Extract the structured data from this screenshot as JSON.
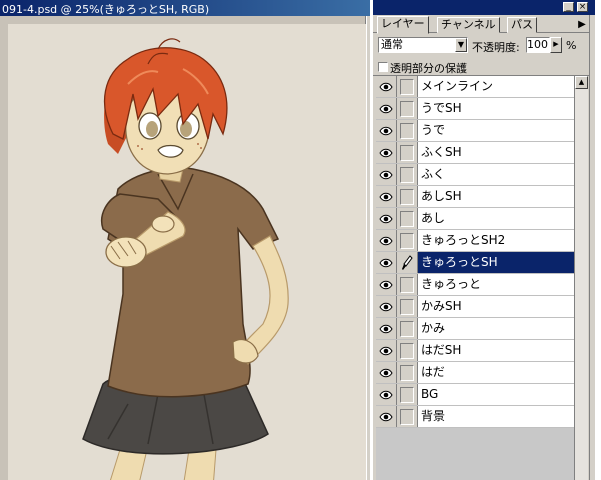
{
  "document": {
    "title": "091-4.psd @ 25%(きゅろっとSH, RGB)"
  },
  "palette": {
    "tabs": [
      "レイヤー",
      "チャンネル",
      "パス"
    ],
    "active_tab": "レイヤー",
    "window_buttons": [
      "_",
      "×"
    ],
    "tab_menu_icon": "▶",
    "blend_mode": "通常",
    "opacity_label": "不透明度:",
    "opacity_value": "100",
    "opacity_unit": "%",
    "preserve_transparency_label": "透明部分の保護",
    "preserve_transparency_checked": false,
    "layers": [
      {
        "name": "メインライン",
        "visible": true,
        "selected": false
      },
      {
        "name": "うでSH",
        "visible": true,
        "selected": false
      },
      {
        "name": "うで",
        "visible": true,
        "selected": false
      },
      {
        "name": "ふくSH",
        "visible": true,
        "selected": false
      },
      {
        "name": "ふく",
        "visible": true,
        "selected": false
      },
      {
        "name": "あしSH",
        "visible": true,
        "selected": false
      },
      {
        "name": "あし",
        "visible": true,
        "selected": false
      },
      {
        "name": "きゅろっとSH2",
        "visible": true,
        "selected": false
      },
      {
        "name": "きゅろっとSH",
        "visible": true,
        "selected": true
      },
      {
        "name": "きゅろっと",
        "visible": true,
        "selected": false
      },
      {
        "name": "かみSH",
        "visible": true,
        "selected": false
      },
      {
        "name": "かみ",
        "visible": true,
        "selected": false
      },
      {
        "name": "はだSH",
        "visible": true,
        "selected": false
      },
      {
        "name": "はだ",
        "visible": true,
        "selected": false
      },
      {
        "name": "BG",
        "visible": true,
        "selected": false
      },
      {
        "name": "背景",
        "visible": true,
        "selected": false
      }
    ]
  },
  "colors": {
    "titlebar": "#0a246a",
    "selection": "#0a246a",
    "canvas_bg": "#e3ddd2",
    "hair": "#d9572b",
    "shirt": "#8a6a4a",
    "skirt": "#4a4744",
    "skin": "#f1dfb6"
  },
  "icons": {
    "visibility": "eye-icon",
    "active_layer": "brush-icon",
    "scroll_up": "triangle-up-icon"
  }
}
